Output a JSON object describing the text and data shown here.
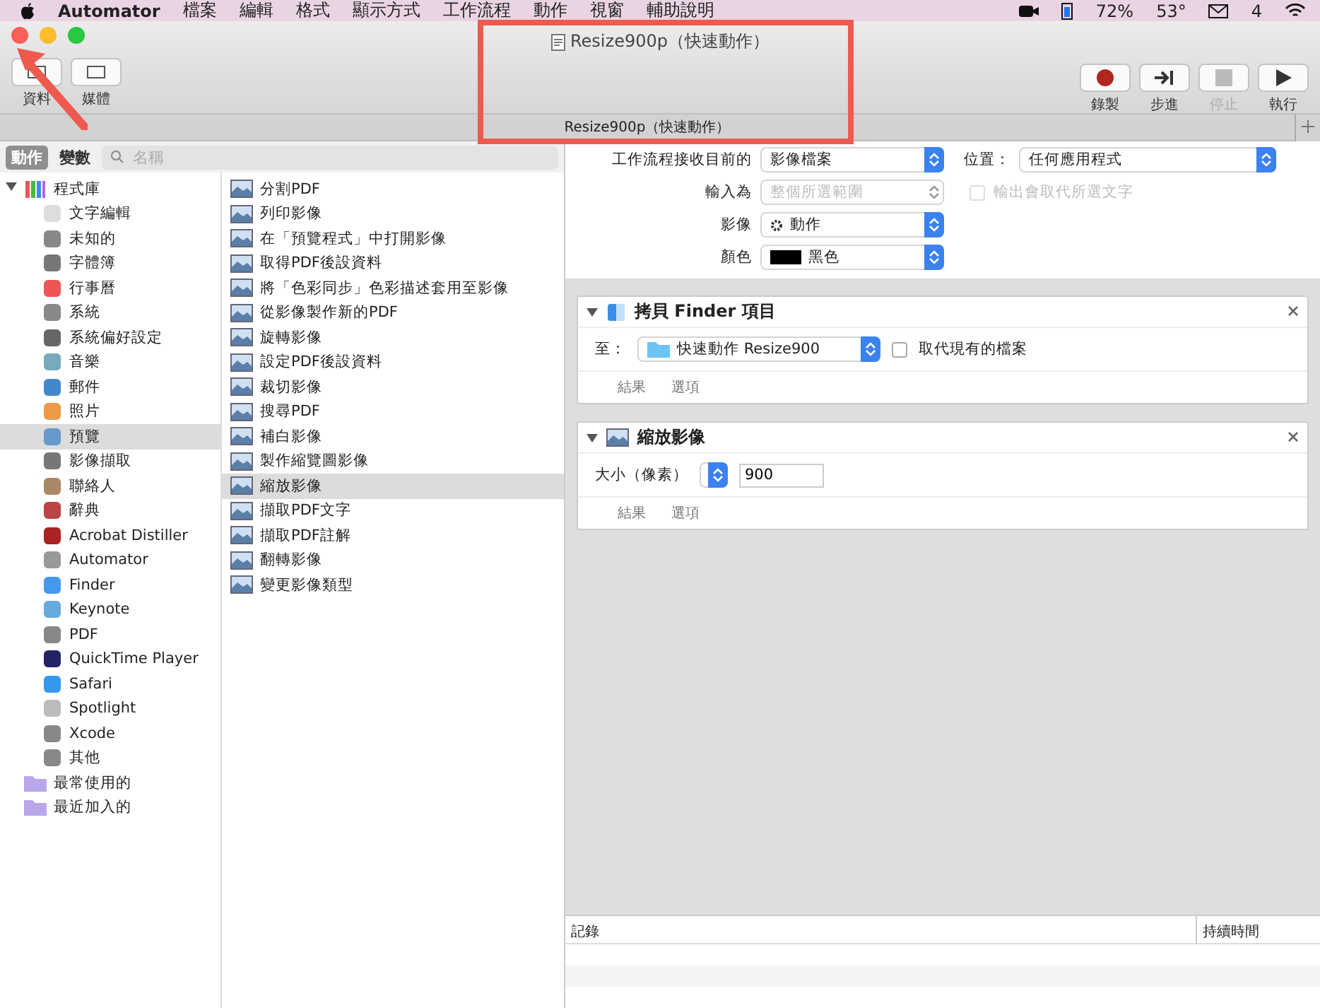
{
  "menubar": {
    "app": "Automator",
    "menus": [
      "檔案",
      "編輯",
      "格式",
      "顯示方式",
      "工作流程",
      "動作",
      "視窗",
      "輔助說明"
    ],
    "battery": "72%",
    "temperature": "53°",
    "mail_count": "4"
  },
  "window": {
    "title": "Resize900p（快速動作）",
    "tab_title": "Resize900p（快速動作）",
    "toolbar_left": [
      {
        "label": "資料"
      },
      {
        "label": "媒體"
      }
    ],
    "toolbar_right": [
      {
        "kind": "record",
        "label": "錄製",
        "disabled": false
      },
      {
        "kind": "step",
        "label": "步進",
        "disabled": false
      },
      {
        "kind": "stop",
        "label": "停止",
        "disabled": true
      },
      {
        "kind": "run",
        "label": "執行",
        "disabled": false
      }
    ]
  },
  "library": {
    "tabs": [
      {
        "label": "動作",
        "selected": true
      },
      {
        "label": "變數",
        "selected": false
      }
    ],
    "search": {
      "placeholder": "名稱"
    },
    "tree": [
      {
        "label": "程式庫",
        "expanded": true,
        "selected": false,
        "children": [
          {
            "label": "文字編輯",
            "selected": false
          },
          {
            "label": "未知的",
            "selected": false
          },
          {
            "label": "字體簿",
            "selected": false
          },
          {
            "label": "行事曆",
            "selected": false
          },
          {
            "label": "系統",
            "selected": false
          },
          {
            "label": "系統偏好設定",
            "selected": false
          },
          {
            "label": "音樂",
            "selected": false
          },
          {
            "label": "郵件",
            "selected": false
          },
          {
            "label": "照片",
            "selected": false
          },
          {
            "label": "預覽",
            "selected": true
          },
          {
            "label": "影像擷取",
            "selected": false
          },
          {
            "label": "聯絡人",
            "selected": false
          },
          {
            "label": "辭典",
            "selected": false
          },
          {
            "label": "Acrobat Distiller",
            "selected": false
          },
          {
            "label": "Automator",
            "selected": false
          },
          {
            "label": "Finder",
            "selected": false
          },
          {
            "label": "Keynote",
            "selected": false
          },
          {
            "label": "PDF",
            "selected": false
          },
          {
            "label": "QuickTime Player",
            "selected": false
          },
          {
            "label": "Safari",
            "selected": false
          },
          {
            "label": "Spotlight",
            "selected": false
          },
          {
            "label": "Xcode",
            "selected": false
          },
          {
            "label": "其他",
            "selected": false
          }
        ]
      },
      {
        "label": "最常使用的",
        "selected": false
      },
      {
        "label": "最近加入的",
        "selected": false
      }
    ]
  },
  "actions": [
    {
      "label": "分割PDF",
      "selected": false
    },
    {
      "label": "列印影像",
      "selected": false
    },
    {
      "label": "在「預覽程式」中打開影像",
      "selected": false
    },
    {
      "label": "取得PDF後設資料",
      "selected": false
    },
    {
      "label": "將「色彩同步」色彩描述套用至影像",
      "selected": false
    },
    {
      "label": "從影像製作新的PDF",
      "selected": false
    },
    {
      "label": "旋轉影像",
      "selected": false
    },
    {
      "label": "設定PDF後設資料",
      "selected": false
    },
    {
      "label": "裁切影像",
      "selected": false
    },
    {
      "label": "搜尋PDF",
      "selected": false
    },
    {
      "label": "補白影像",
      "selected": false
    },
    {
      "label": "製作縮覽圖影像",
      "selected": false
    },
    {
      "label": "縮放影像",
      "selected": true
    },
    {
      "label": "擷取PDF文字",
      "selected": false
    },
    {
      "label": "擷取PDF註解",
      "selected": false
    },
    {
      "label": "翻轉影像",
      "selected": false
    },
    {
      "label": "變更影像類型",
      "selected": false
    }
  ],
  "workflow": {
    "settings": [
      {
        "label": "工作流程接收目前的",
        "value": "影像檔案",
        "disabled": false,
        "kind": "select",
        "extra": {
          "kind": "select",
          "label": "位置：",
          "value": "任何應用程式"
        }
      },
      {
        "label": "輸入為",
        "value": "整個所選範圍",
        "disabled": true,
        "kind": "select",
        "extra": {
          "kind": "checkbox",
          "label": "輸出會取代所選文字",
          "checked": false,
          "disabled": true
        }
      },
      {
        "label": "影像",
        "value": "動作",
        "disabled": false,
        "kind": "gear"
      },
      {
        "label": "顏色",
        "value": "黑色",
        "disabled": false,
        "kind": "swatch",
        "color": "#000000"
      }
    ],
    "steps": [
      {
        "title": "拷貝 Finder 項目",
        "expanded": true,
        "kind": "copy",
        "field_label": "至：",
        "value": "快速動作 Resize900",
        "checkbox": {
          "label": "取代現有的檔案",
          "checked": false
        },
        "footer": [
          "結果",
          "選項"
        ]
      },
      {
        "title": "縮放影像",
        "expanded": true,
        "kind": "scale",
        "field_label": "大小（像素）",
        "value": "900",
        "footer": [
          "結果",
          "選項"
        ]
      }
    ]
  },
  "log": {
    "columns": [
      "記錄",
      "持續時間"
    ]
  }
}
